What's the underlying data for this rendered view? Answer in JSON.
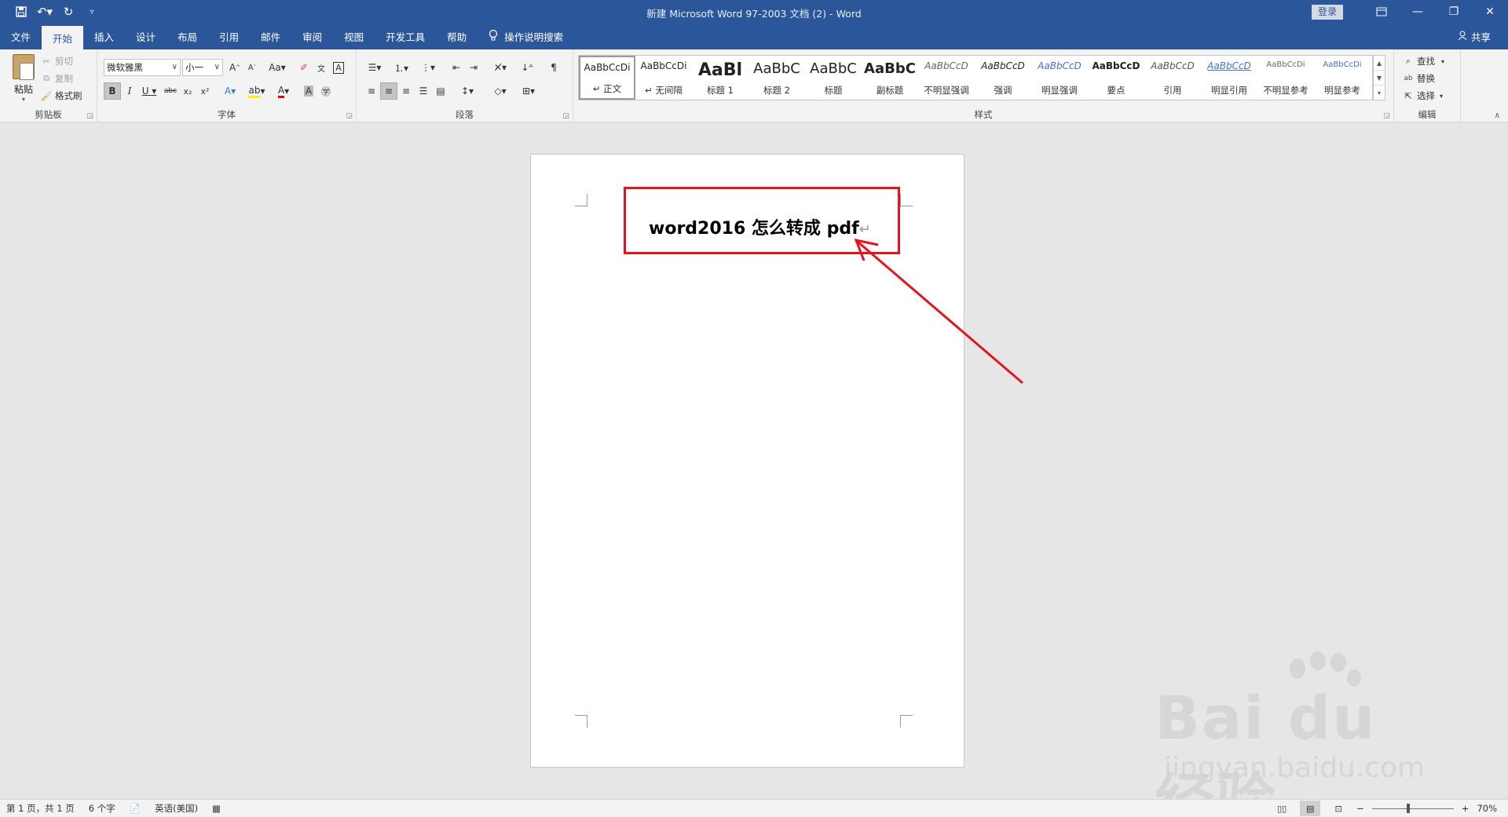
{
  "window": {
    "title": "新建 Microsoft Word 97-2003 文档 (2)  -  Word",
    "login": "登录"
  },
  "tabs": [
    "文件",
    "开始",
    "插入",
    "设计",
    "布局",
    "引用",
    "邮件",
    "审阅",
    "视图",
    "开发工具",
    "帮助"
  ],
  "tell_me": "操作说明搜索",
  "share": "共享",
  "clipboard": {
    "paste": "粘贴",
    "cut": "剪切",
    "copy": "复制",
    "format_painter": "格式刷",
    "label": "剪贴板"
  },
  "font": {
    "name": "微软雅黑",
    "size": "小一",
    "label": "字体"
  },
  "paragraph": {
    "label": "段落"
  },
  "styles": {
    "label": "样式",
    "items": [
      {
        "preview": "AaBbCcDi",
        "name": "↵ 正文"
      },
      {
        "preview": "AaBbCcDi",
        "name": "↵ 无间隔"
      },
      {
        "preview": "AaBl",
        "name": "标题 1"
      },
      {
        "preview": "AaBbC",
        "name": "标题 2"
      },
      {
        "preview": "AaBbC",
        "name": "标题"
      },
      {
        "preview": "AaBbC",
        "name": "副标题"
      },
      {
        "preview": "AaBbCcD",
        "name": "不明显强调"
      },
      {
        "preview": "AaBbCcD",
        "name": "强调"
      },
      {
        "preview": "AaBbCcD",
        "name": "明显强调"
      },
      {
        "preview": "AaBbCcD",
        "name": "要点"
      },
      {
        "preview": "AaBbCcD",
        "name": "引用"
      },
      {
        "preview": "AaBbCcD",
        "name": "明显引用"
      },
      {
        "preview": "AaBbCcDi",
        "name": "不明显参考"
      },
      {
        "preview": "AaBbCcDi",
        "name": "明显参考"
      }
    ]
  },
  "editing": {
    "find": "查找",
    "replace": "替换",
    "select": "选择",
    "label": "编辑"
  },
  "document": {
    "text": "word2016 怎么转成 pdf",
    "para_mark": "↵"
  },
  "watermark": {
    "brand": "Bai du 经验",
    "url": "jingyan.baidu.com"
  },
  "status": {
    "page": "第 1 页，共 1 页",
    "words": "6 个字",
    "language": "英语(美国)",
    "zoom": "70%",
    "zoom_minus": "−",
    "zoom_plus": "+"
  },
  "colors": {
    "accent": "#2b579a",
    "highlight_red": "#e3141c"
  }
}
